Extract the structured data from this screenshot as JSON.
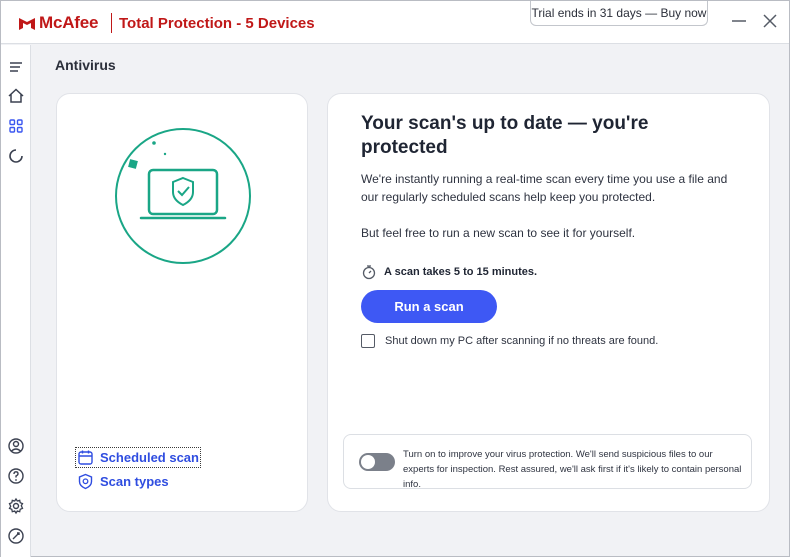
{
  "app": {
    "brand": "McAfee",
    "product": "Total Protection - 5 Devices",
    "trial": "Trial ends in 31 days — Buy now"
  },
  "sidebar": {
    "items": [
      {
        "icon": "menu-icon"
      },
      {
        "icon": "home-icon"
      },
      {
        "icon": "grid-icon",
        "active": true
      },
      {
        "icon": "refresh-icon"
      },
      {
        "icon": "account-icon"
      },
      {
        "icon": "help-icon"
      },
      {
        "icon": "settings-icon"
      },
      {
        "icon": "feedback-icon"
      }
    ]
  },
  "page": {
    "title": "Antivirus"
  },
  "left_card": {
    "scheduled_scan": "Scheduled scan",
    "scan_types": "Scan types"
  },
  "right_card": {
    "headline": "Your scan's up to date — you're protected",
    "desc1": "We're instantly running a real-time scan every time you use a file and our regularly scheduled scans help keep you protected.",
    "desc2": "But feel free to run a new scan to see it for yourself.",
    "duration": "A scan takes 5 to 15 minutes.",
    "run_button": "Run a scan",
    "shutdown_label": "Shut down my PC after scanning if no threats are found.",
    "shutdown_checked": false,
    "share_text": "Turn on to improve your virus protection. We'll send suspicious files to our experts for inspection. Rest assured, we'll ask first if it's likely to contain personal info.",
    "share_enabled": false
  },
  "colors": {
    "brand": "#c01818",
    "accent": "#3e58f4",
    "illustration": "#1aa686"
  }
}
